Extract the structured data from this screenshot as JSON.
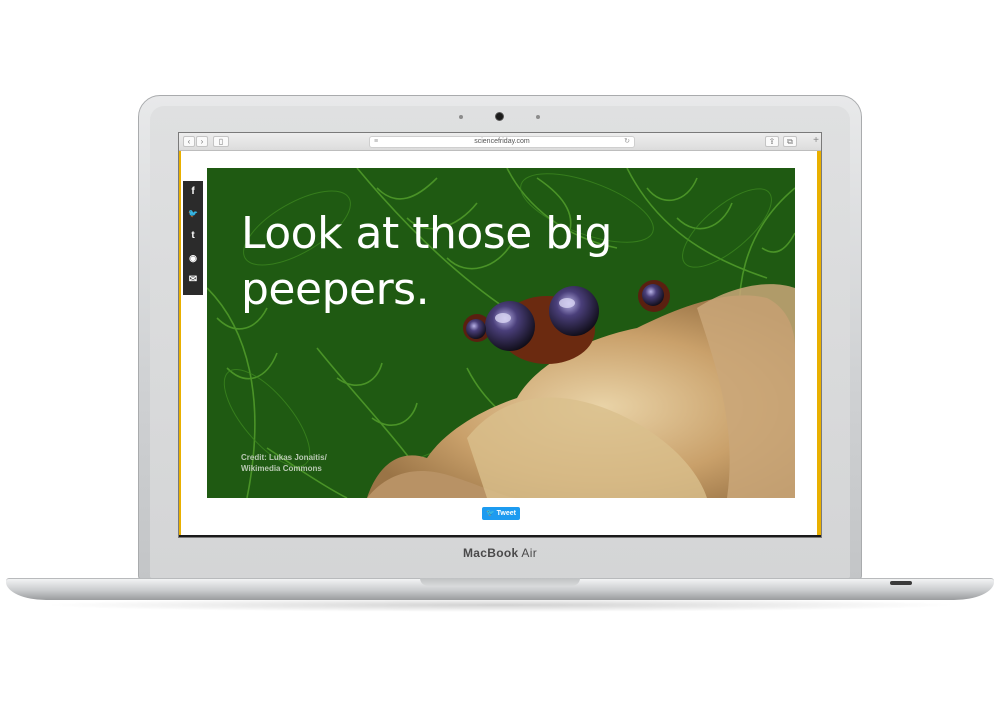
{
  "browser": {
    "url": "sciencefriday.com",
    "back_icon": "chevron-left-icon",
    "forward_icon": "chevron-right-icon",
    "sidebar_icon": "sidebar-icon",
    "reload_icon": "reload-icon",
    "share_icon": "share-icon",
    "tabs_icon": "tabs-icon",
    "new_tab_icon": "plus-icon"
  },
  "share_bar": {
    "items": [
      {
        "icon": "facebook-icon",
        "glyph": "f"
      },
      {
        "icon": "twitter-icon",
        "glyph": "🐦"
      },
      {
        "icon": "tumblr-icon",
        "glyph": "t"
      },
      {
        "icon": "reddit-icon",
        "glyph": "◉"
      },
      {
        "icon": "email-icon",
        "glyph": "✉"
      }
    ]
  },
  "card": {
    "headline": "Look at those big peepers.",
    "credit_line1": "Credit: Lukas Jonaitis/",
    "credit_line2": "Wikimedia Commons"
  },
  "tweet_button": {
    "label": "Tweet",
    "icon": "twitter-icon"
  },
  "device": {
    "brand": "MacBook",
    "model": "Air"
  },
  "colors": {
    "card_bg": "#1f5a12",
    "accent_yellow": "#e9b000",
    "tweet_blue": "#1d9bf0"
  }
}
